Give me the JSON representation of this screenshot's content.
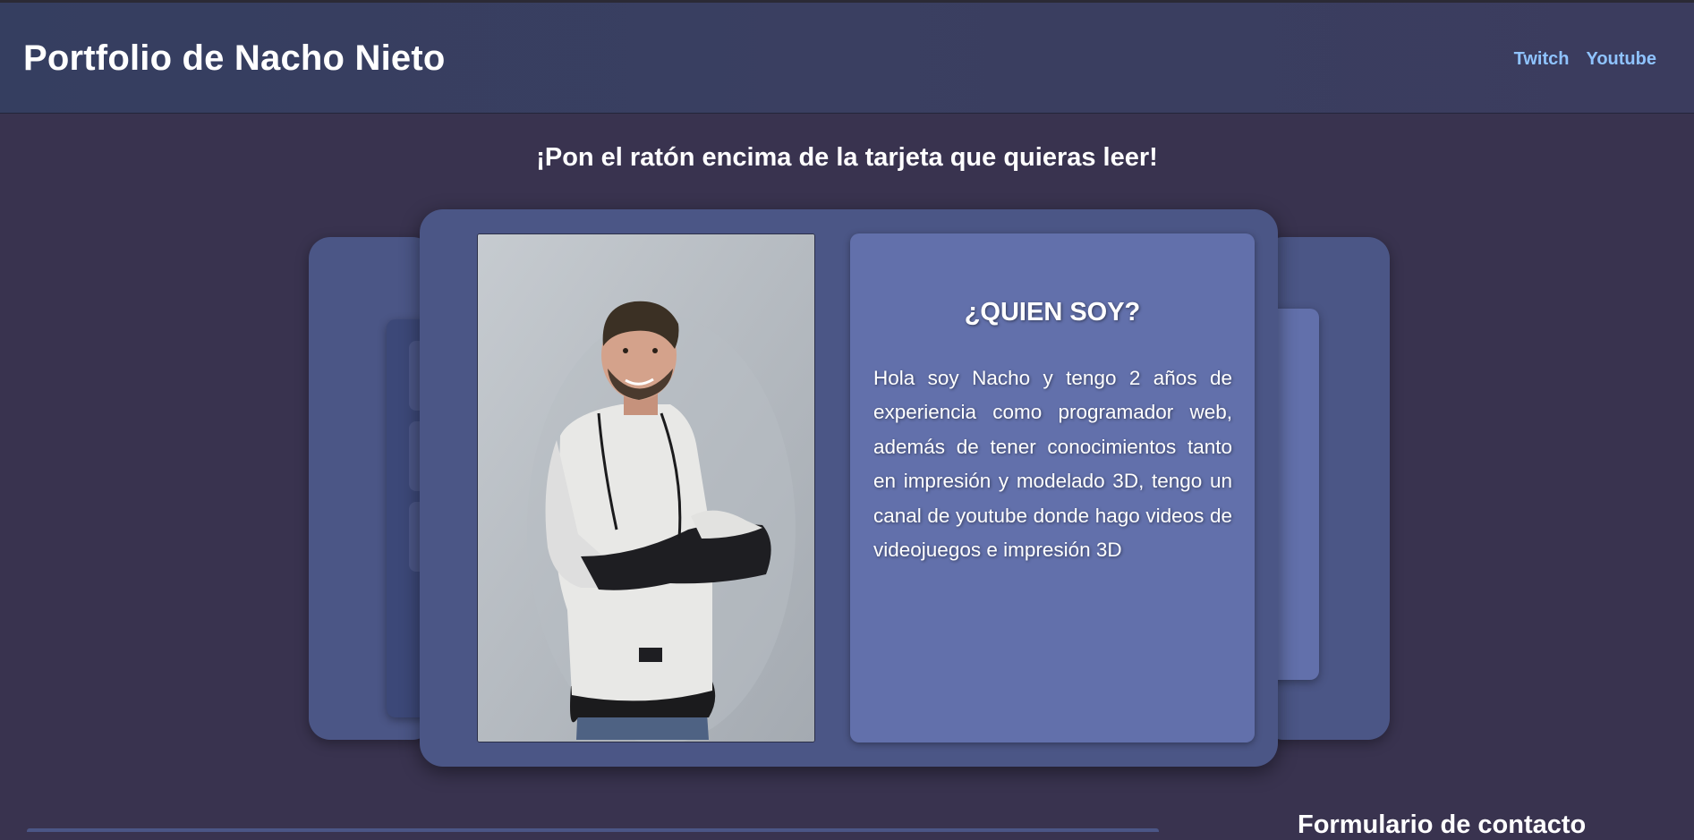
{
  "header": {
    "title": "Portfolio de Nacho Nieto",
    "nav": [
      {
        "label": "Twitch"
      },
      {
        "label": "Youtube"
      }
    ]
  },
  "hint": "¡Pon el ratón encima de la tarjeta que quieras leer!",
  "card": {
    "photo_alt": "Nacho Nieto",
    "title": "¿QUIEN SOY?",
    "body": "Hola soy Nacho y tengo 2 años de experiencia como programador web, además de tener conocimientos tanto en impresión y modelado 3D, tengo un canal de youtube donde hago videos de videojuegos e impresión 3D"
  },
  "contact": {
    "title": "Formulario de contacto"
  },
  "colors": {
    "page_bg": "#39334f",
    "header_bg": "#383e60",
    "card_bg": "#4b5686",
    "panel_bg": "#6270ab",
    "nav_link": "#8fc3ff"
  }
}
